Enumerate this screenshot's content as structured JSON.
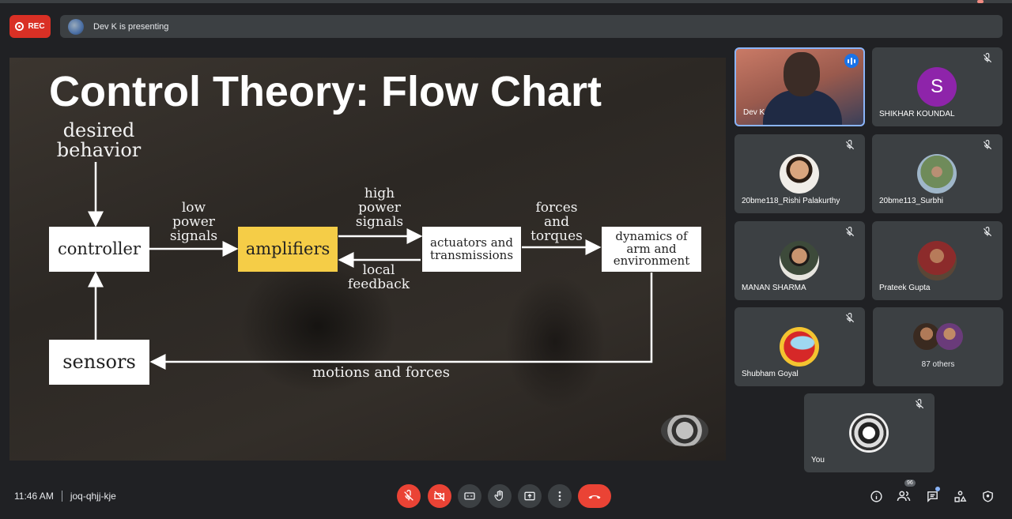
{
  "recording": {
    "label": "REC"
  },
  "presenting": {
    "text": "Dev K is presenting"
  },
  "slide": {
    "title": "Control Theory: Flow Chart",
    "desired_behavior": "desired behavior",
    "controller": "controller",
    "low_power_signals": "low power signals",
    "amplifiers": "amplifiers",
    "high_power_signals": "high power signals",
    "local_feedback": "local feedback",
    "actuators": "actuators and transmissions",
    "forces_torques": "forces and torques",
    "dynamics": "dynamics of arm and environment",
    "sensors": "sensors",
    "motions_forces": "motions and forces"
  },
  "participants": [
    {
      "name": "Dev K",
      "speaking": true
    },
    {
      "name": "SHIKHAR KOUNDAL",
      "initial": "S",
      "avatar_color": "#8e24aa",
      "muted": true
    },
    {
      "name": "20bme118_Rishi Palakurthy",
      "muted": true
    },
    {
      "name": "20bme113_Surbhi",
      "muted": true
    },
    {
      "name": "MANAN SHARMA",
      "muted": true
    },
    {
      "name": "Prateek Gupta",
      "muted": true
    },
    {
      "name": "Shubham Goyal",
      "muted": true
    },
    {
      "name": "87 others"
    },
    {
      "name": "You",
      "muted": true
    }
  ],
  "bottom": {
    "time": "11:46 AM",
    "meeting_code": "joq-qhjj-kje",
    "people_count": "96"
  },
  "colors": {
    "accent": "#8ab4f8",
    "danger": "#ea4335",
    "amplifier": "#f5cd47"
  }
}
